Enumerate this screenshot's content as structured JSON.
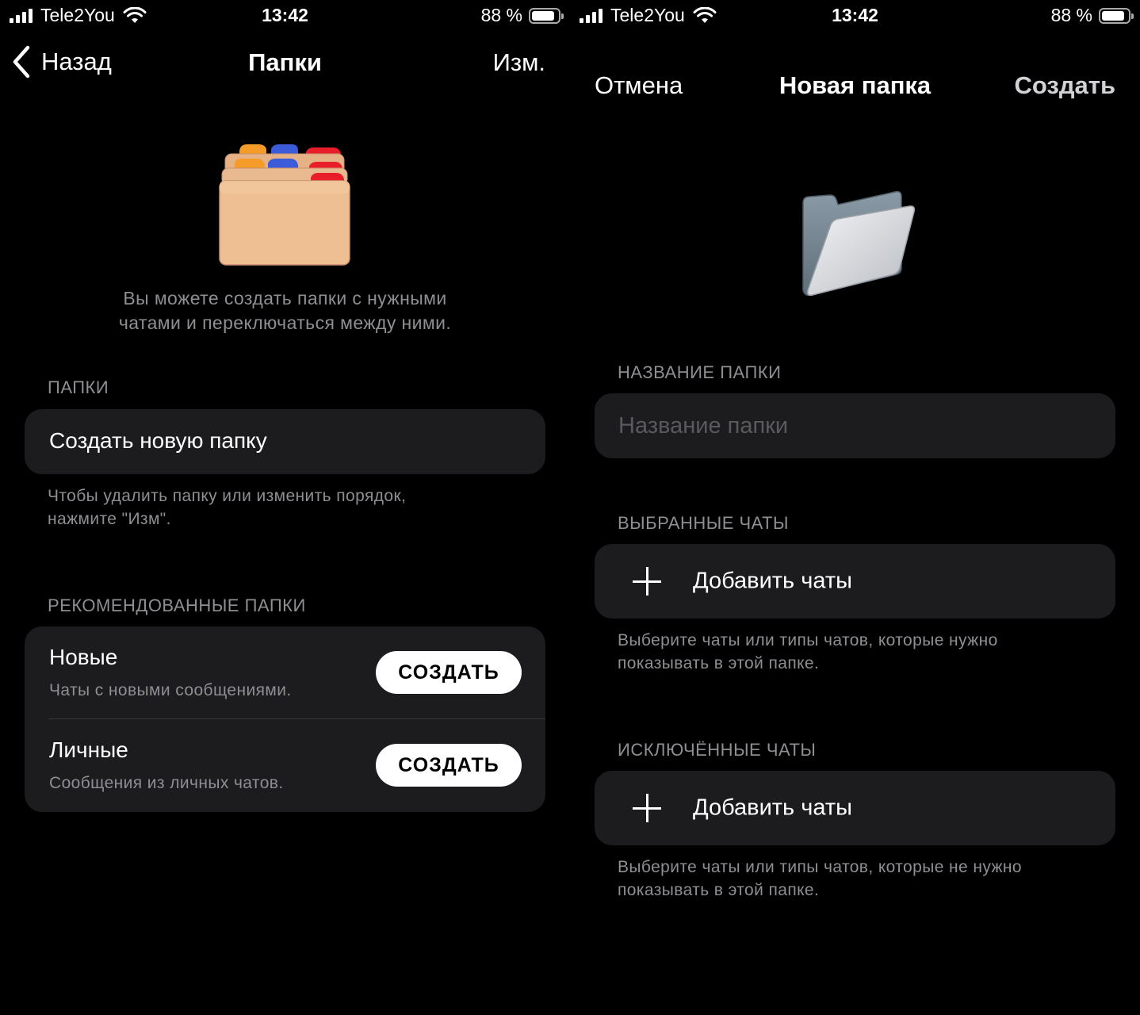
{
  "status_bar": {
    "carrier": "Tele2You",
    "time": "13:42",
    "battery_text": "88 %",
    "battery_level": 0.88
  },
  "left": {
    "nav": {
      "back_label": "Назад",
      "title": "Папки",
      "edit_label": "Изм."
    },
    "intro": {
      "line1": "Вы можете создать папки с нужными",
      "line2": "чатами и переключаться между ними."
    },
    "folders_section": {
      "header": "ПАПКИ",
      "create_label": "Создать новую папку",
      "footer_line1": "Чтобы удалить папку или изменить порядок,",
      "footer_line2": "нажмите \"Изм\"."
    },
    "recommended_section": {
      "header": "РЕКОМЕНДОВАННЫЕ ПАПКИ",
      "items": [
        {
          "title": "Новые",
          "subtitle": "Чаты с новыми сообщениями.",
          "button": "СОЗДАТЬ"
        },
        {
          "title": "Личные",
          "subtitle": "Сообщения из личных чатов.",
          "button": "СОЗДАТЬ"
        }
      ]
    }
  },
  "right": {
    "nav": {
      "cancel_label": "Отмена",
      "title": "Новая папка",
      "create_label": "Создать"
    },
    "name_section": {
      "header": "НАЗВАНИЕ ПАПКИ",
      "placeholder": "Название папки"
    },
    "included_section": {
      "header": "ВЫБРАННЫЕ ЧАТЫ",
      "add_label": "Добавить чаты",
      "footer_line1": "Выберите чаты или типы чатов, которые нужно",
      "footer_line2": "показывать в этой папке."
    },
    "excluded_section": {
      "header": "ИСКЛЮЧЁННЫЕ ЧАТЫ",
      "add_label": "Добавить чаты",
      "footer_line1": "Выберите чаты или типы чатов, которые не нужно",
      "footer_line2": "показывать в этой папке."
    }
  }
}
